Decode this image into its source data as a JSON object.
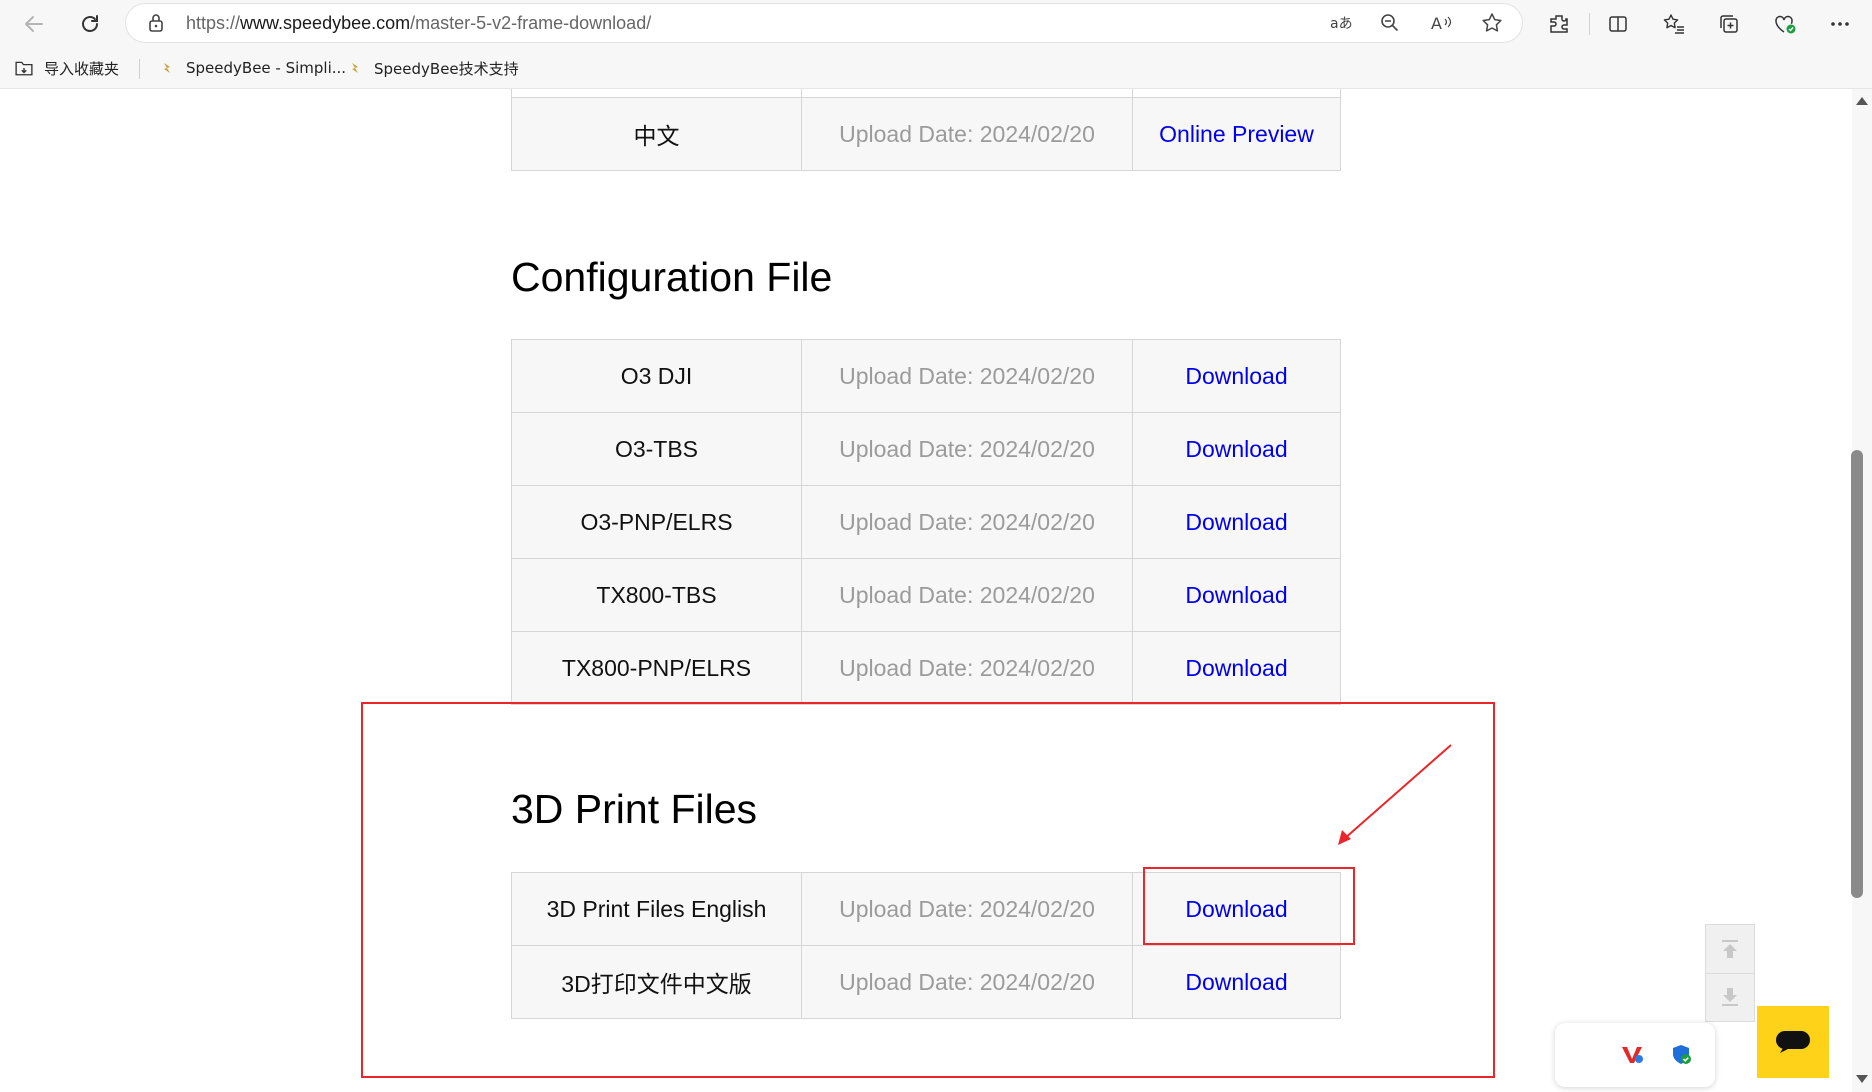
{
  "browser": {
    "url_prefix": "https://",
    "url_host": "www.speedybee.com",
    "url_path": "/master-5-v2-frame-download/",
    "bookmarks": [
      {
        "label": "导入收藏夹"
      },
      {
        "label": "SpeedyBee - Simpli..."
      },
      {
        "label": "SpeedyBee技术支持"
      }
    ]
  },
  "top_table": {
    "rows": [
      {
        "name": "中文",
        "date": "Upload Date: 2024/02/20",
        "action": "Online Preview"
      }
    ]
  },
  "config_section": {
    "title": "Configuration File",
    "rows": [
      {
        "name": "O3 DJI",
        "date": "Upload Date: 2024/02/20",
        "action": "Download"
      },
      {
        "name": "O3-TBS",
        "date": "Upload Date: 2024/02/20",
        "action": "Download"
      },
      {
        "name": "O3-PNP/ELRS",
        "date": "Upload Date: 2024/02/20",
        "action": "Download"
      },
      {
        "name": "TX800-TBS",
        "date": "Upload Date: 2024/02/20",
        "action": "Download"
      },
      {
        "name": "TX800-PNP/ELRS",
        "date": "Upload Date: 2024/02/20",
        "action": "Download"
      }
    ]
  },
  "print_section": {
    "title": "3D Print Files",
    "rows": [
      {
        "name": "3D Print Files English",
        "date": "Upload Date: 2024/02/20",
        "action": "Download"
      },
      {
        "name": "3D打印文件中文版",
        "date": "Upload Date: 2024/02/20",
        "action": "Download"
      }
    ]
  },
  "colors": {
    "annotation": "#e8262b",
    "link": "#0000ee",
    "chat_button": "#ffd21a"
  }
}
